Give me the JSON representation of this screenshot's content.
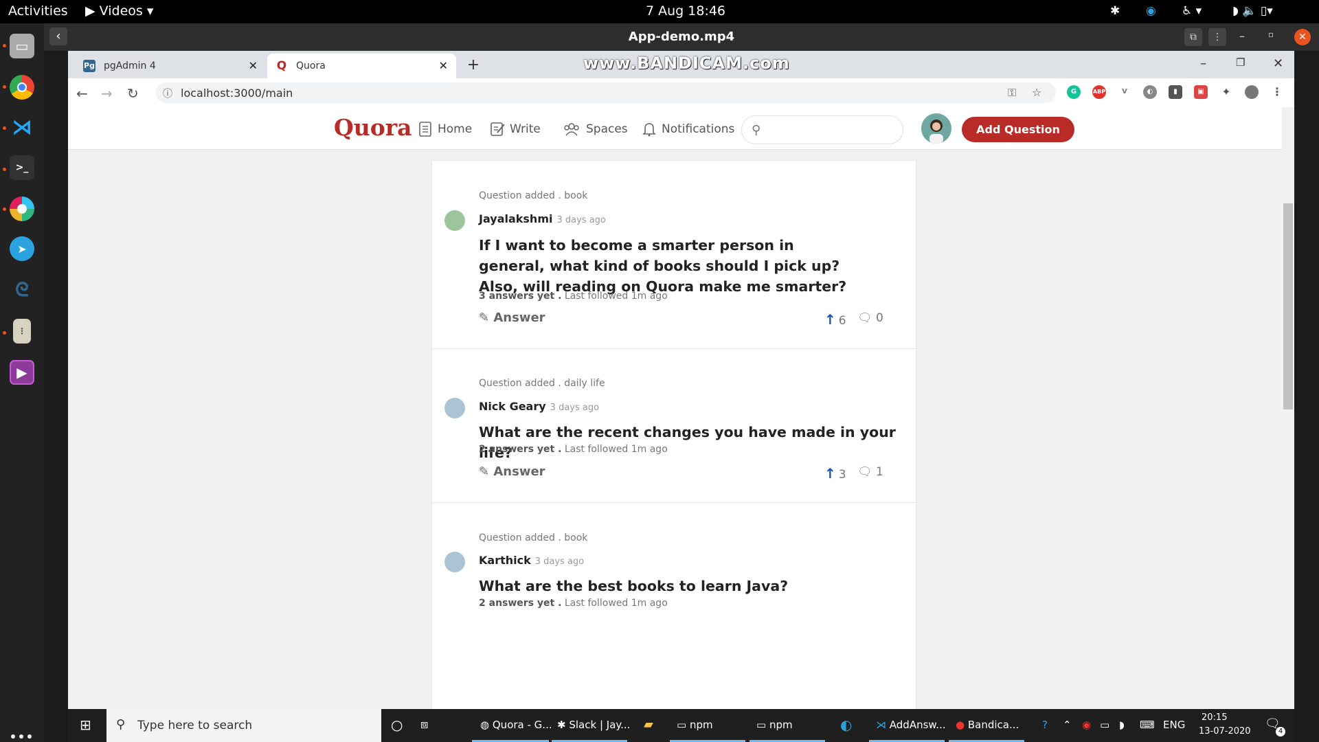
{
  "ubuntu": {
    "activities": "Activities",
    "app_menu": "▶ Videos ▾",
    "clock": "7 Aug  18:46"
  },
  "player": {
    "title": "App-demo.mp4"
  },
  "browser": {
    "tabs": [
      {
        "label": "pgAdmin 4",
        "favicon": "Pg"
      },
      {
        "label": "Quora",
        "favicon": "Q"
      }
    ],
    "watermark": "www.BANDICAM.com",
    "url": "localhost:3000/main"
  },
  "quora": {
    "logo": "Quora",
    "nav": {
      "home": "Home",
      "write": "Write",
      "spaces": "Spaces",
      "notifications": "Notifications"
    },
    "add_question": "Add Question"
  },
  "posts": [
    {
      "added": "Question added . book",
      "author": "Jayalakshmi",
      "ago": "3 days ago",
      "question": "If I want to become a smarter person in general, what kind of books should I pick up? Also, will reading on Quora make me smarter?",
      "answers": "3 answers yet .",
      "followed": "Last followed 1m ago",
      "answer_label": "Answer",
      "upvotes": "6",
      "comments": "0"
    },
    {
      "added": "Question added . daily life",
      "author": "Nick Geary",
      "ago": "3 days ago",
      "question": "What are the recent changes you have made in your life?",
      "answers": "2 answers yet .",
      "followed": "Last followed 1m ago",
      "answer_label": "Answer",
      "upvotes": "3",
      "comments": "1"
    },
    {
      "added": "Question added . book",
      "author": "Karthick",
      "ago": "3 days ago",
      "question": "What are the best books to learn Java?",
      "answers": "2 answers yet .",
      "followed": "Last followed 1m ago"
    }
  ],
  "taskbar": {
    "search_placeholder": "Type here to search",
    "apps": [
      "Quora - G...",
      "Slack | Jay...",
      "npm",
      "npm",
      "AddAnsw...",
      "Bandica..."
    ],
    "lang": "ENG",
    "time": "20:15",
    "date": "13-07-2020",
    "notif_count": "4"
  },
  "colors": {
    "quora_red": "#b92b27",
    "upvote_blue": "#1b4fb4"
  }
}
